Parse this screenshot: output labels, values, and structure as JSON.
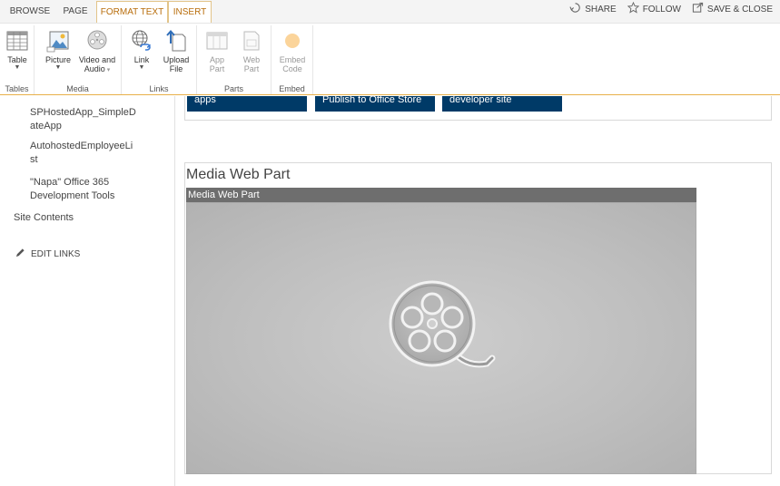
{
  "tabs": {
    "browse": "BROWSE",
    "page": "PAGE",
    "format_text": "FORMAT TEXT",
    "insert": "INSERT"
  },
  "top_actions": {
    "share": "SHARE",
    "follow": "FOLLOW",
    "save_close": "SAVE & CLOSE"
  },
  "ribbon": {
    "groups": {
      "tables": "Tables",
      "media": "Media",
      "links": "Links",
      "parts": "Parts",
      "embed": "Embed"
    },
    "buttons": {
      "table": "Table",
      "picture": "Picture",
      "video_audio_1": "Video and",
      "video_audio_2": "Audio",
      "link": "Link",
      "upload_1": "Upload",
      "upload_2": "File",
      "app_part_1": "App",
      "app_part_2": "Part",
      "web_part_1": "Web",
      "web_part_2": "Part",
      "embed_1": "Embed",
      "embed_2": "Code"
    }
  },
  "leftnav": {
    "items": [
      {
        "line1": "SPHostedApp_SimpleD",
        "line2": "ateApp"
      },
      {
        "line1": "AutohostedEmployeeLi",
        "line2": "st"
      },
      {
        "line1": "\"Napa\" Office 365",
        "line2": "Development Tools"
      }
    ],
    "site_contents": "Site Contents",
    "edit_links": "EDIT LINKS"
  },
  "tiles": [
    "apps",
    "Publish to Office Store",
    "developer site"
  ],
  "media_web_part": {
    "title": "Media Web Part",
    "header": "Media Web Part"
  },
  "colors": {
    "accent": "#b86d0b",
    "tile": "#003a67",
    "ribbon_border": "#e8b04a"
  }
}
